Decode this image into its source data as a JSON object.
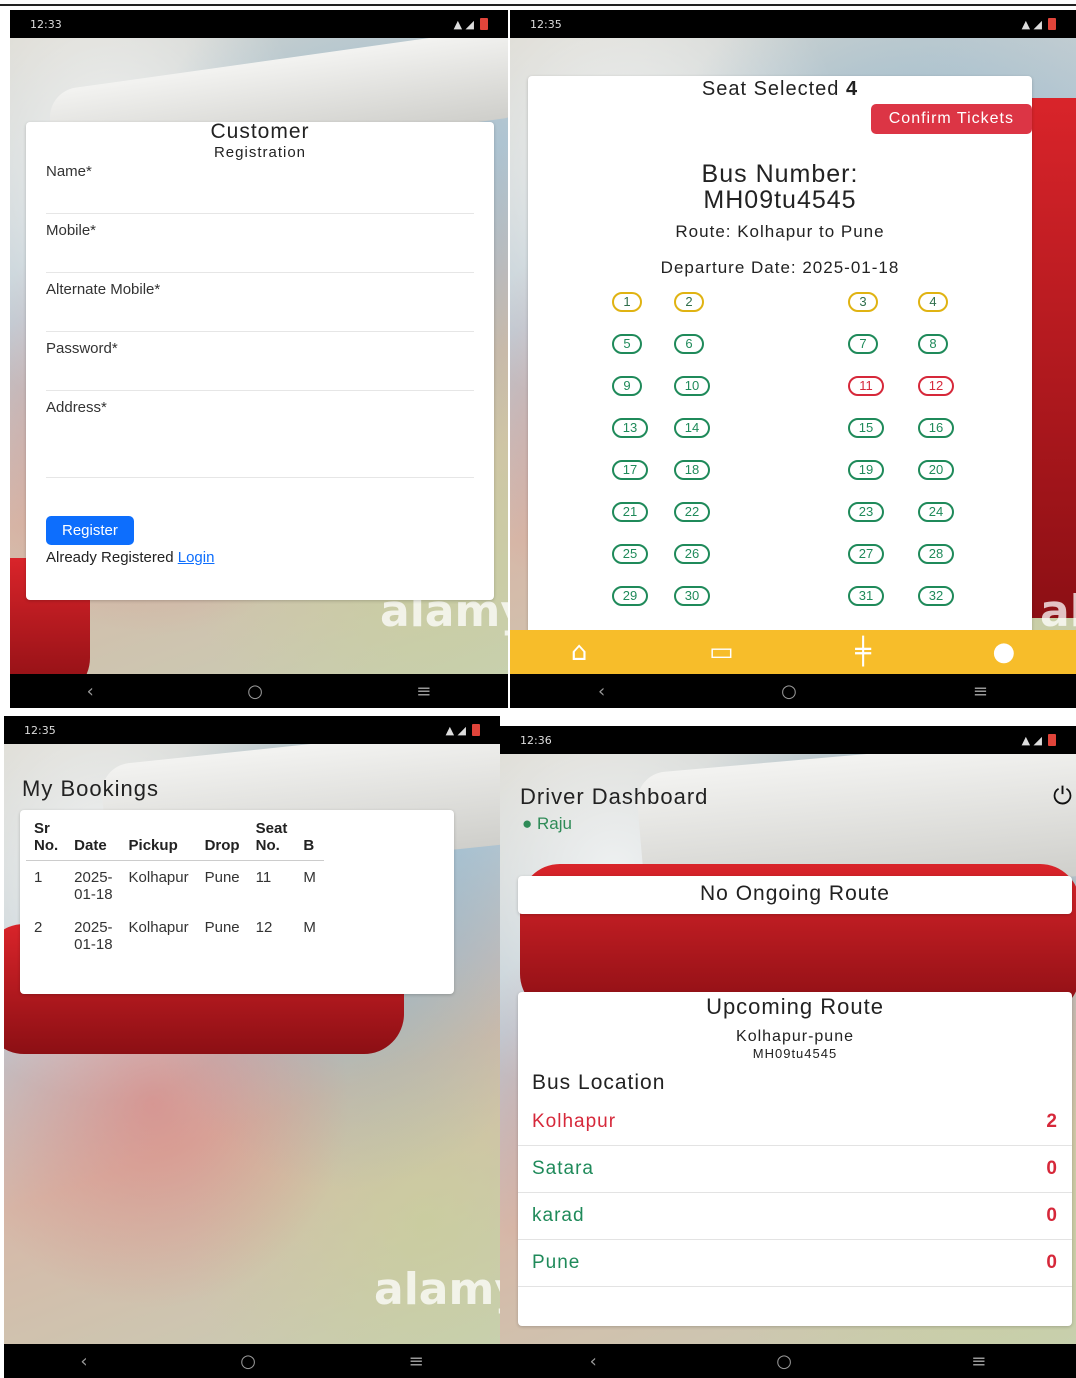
{
  "registration": {
    "status_time": "12:33",
    "title": "Customer",
    "subtitle": "Registration",
    "fields": [
      {
        "label": "Name*",
        "value": ""
      },
      {
        "label": "Mobile*",
        "value": ""
      },
      {
        "label": "Alternate Mobile*",
        "value": ""
      },
      {
        "label": "Password*",
        "value": ""
      },
      {
        "label": "Address*",
        "value": ""
      }
    ],
    "register_label": "Register",
    "already_text": "Already Registered",
    "login_link": "Login"
  },
  "seats": {
    "status_time": "12:35",
    "seat_selected_label": "Seat Selected",
    "seat_selected_count": "4",
    "confirm_label": "Confirm Tickets",
    "bus_number_label": "Bus Number:",
    "bus_number": "MH09tu4545",
    "route": "Route: Kolhapur to Pune",
    "departure": "Departure Date: 2025-01-18",
    "seat_list": [
      {
        "n": "1",
        "state": "selected"
      },
      {
        "n": "2",
        "state": "selected"
      },
      {
        "n": "3",
        "state": "selected"
      },
      {
        "n": "4",
        "state": "selected"
      },
      {
        "n": "5",
        "state": "available"
      },
      {
        "n": "6",
        "state": "available"
      },
      {
        "n": "7",
        "state": "available"
      },
      {
        "n": "8",
        "state": "available"
      },
      {
        "n": "9",
        "state": "available"
      },
      {
        "n": "10",
        "state": "available"
      },
      {
        "n": "11",
        "state": "booked"
      },
      {
        "n": "12",
        "state": "booked"
      },
      {
        "n": "13",
        "state": "available"
      },
      {
        "n": "14",
        "state": "available"
      },
      {
        "n": "15",
        "state": "available"
      },
      {
        "n": "16",
        "state": "available"
      },
      {
        "n": "17",
        "state": "available"
      },
      {
        "n": "18",
        "state": "available"
      },
      {
        "n": "19",
        "state": "available"
      },
      {
        "n": "20",
        "state": "available"
      },
      {
        "n": "21",
        "state": "available"
      },
      {
        "n": "22",
        "state": "available"
      },
      {
        "n": "23",
        "state": "available"
      },
      {
        "n": "24",
        "state": "available"
      },
      {
        "n": "25",
        "state": "available"
      },
      {
        "n": "26",
        "state": "available"
      },
      {
        "n": "27",
        "state": "available"
      },
      {
        "n": "28",
        "state": "available"
      },
      {
        "n": "29",
        "state": "available"
      },
      {
        "n": "30",
        "state": "available"
      },
      {
        "n": "31",
        "state": "available"
      },
      {
        "n": "32",
        "state": "available"
      }
    ],
    "bottom_nav": [
      "home-icon",
      "bus-icon",
      "route-sign-icon",
      "user-icon"
    ],
    "colors": {
      "selected": "#e0b312",
      "available": "#1f8a5a",
      "booked": "#d6283a",
      "nav": "#f7bd2a"
    }
  },
  "bookings": {
    "status_time": "12:35",
    "title": "My Bookings",
    "headers": [
      [
        "Sr",
        "No."
      ],
      [
        "",
        "Date"
      ],
      [
        "",
        "Pickup"
      ],
      [
        "",
        "Drop"
      ],
      [
        "Seat",
        "No."
      ],
      [
        "",
        "B"
      ]
    ],
    "rows": [
      [
        "1",
        "2025-\n01-18",
        "Kolhapur",
        "Pune",
        "11",
        "M"
      ],
      [
        "2",
        "2025-\n01-18",
        "Kolhapur",
        "Pune",
        "12",
        "M"
      ]
    ]
  },
  "driver": {
    "status_time": "12:36",
    "title": "Driver Dashboard",
    "driver_name": "Raju",
    "ongoing": "No Ongoing Route",
    "upcoming_title": "Upcoming Route",
    "route_name": "Kolhapur-pune",
    "bus_number": "MH09tu4545",
    "location_title": "Bus Location",
    "locations": [
      {
        "name": "Kolhapur",
        "count": "2",
        "current": true
      },
      {
        "name": "Satara",
        "count": "0",
        "current": false
      },
      {
        "name": "karad",
        "count": "0",
        "current": false
      },
      {
        "name": "Pune",
        "count": "0",
        "current": false
      }
    ]
  },
  "watermark": "alamy"
}
